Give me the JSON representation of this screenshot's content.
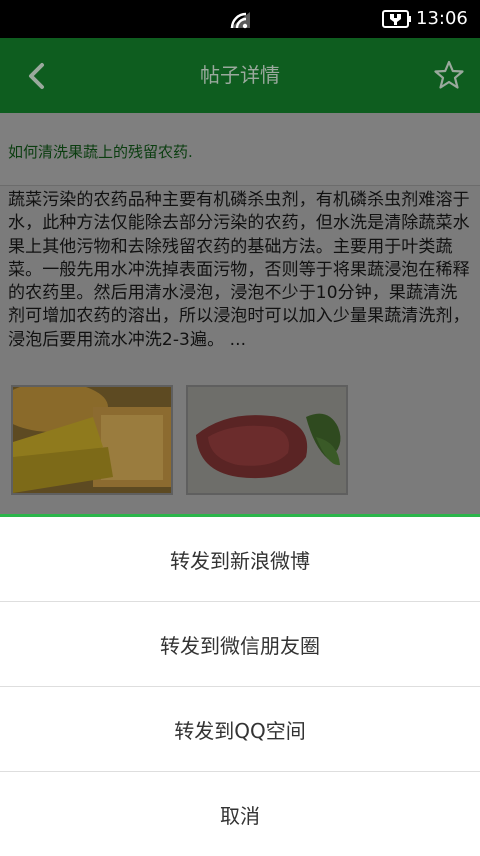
{
  "status_bar": {
    "time": "13:06",
    "wifi_icon": "wifi-icon",
    "battery_icon": "battery-charging-icon"
  },
  "app_bar": {
    "title": "帖子详情",
    "back_icon": "back-arrow-icon",
    "favorite_icon": "star-outline-icon"
  },
  "post": {
    "title": "如何清洗果蔬上的残留农药.",
    "body": "蔬菜污染的农药品种主要有机磷杀虫剂，有机磷杀虫剂难溶于水，此种方法仅能除去部分污染的农药，但水洗是清除蔬菜水果上其他污物和去除残留农药的基础方法。主要用于叶类蔬菜。一般先用水冲洗掉表面污物，否则等于将果蔬浸泡在稀释的农药里。然后用清水浸泡，浸泡不少于10分钟，果蔬清洗剂可增加农药的溶出，所以浸泡时可以加入少量果蔬清洗剂，浸泡后要用流水冲洗2-3遍。 ...",
    "images": [
      "bread-and-cheese-image",
      "raw-steak-image"
    ]
  },
  "share_sheet": {
    "items": [
      {
        "label": "转发到新浪微博"
      },
      {
        "label": "转发到微信朋友圈"
      },
      {
        "label": "转发到QQ空间"
      },
      {
        "label": "取消"
      }
    ]
  },
  "colors": {
    "app_bar": "#0e5d1f",
    "accent": "#2bb54a",
    "dim_overlay": "#7b7b7b"
  }
}
